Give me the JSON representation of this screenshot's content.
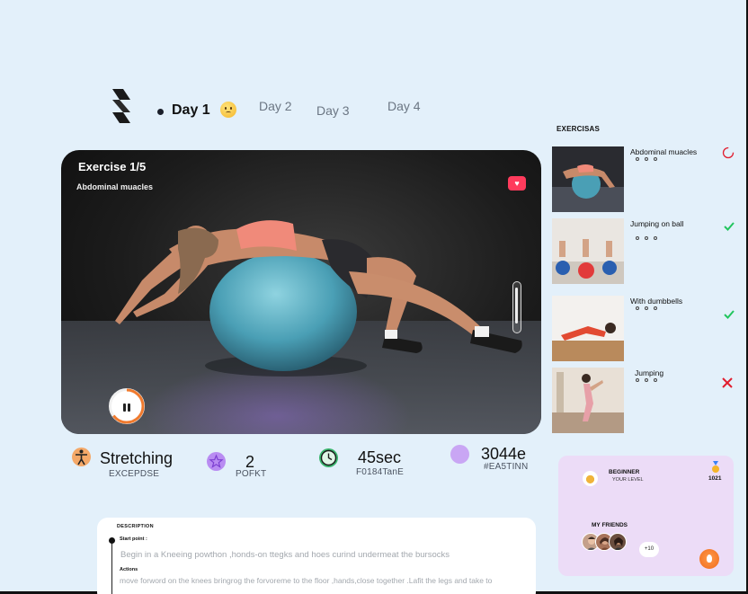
{
  "tabs": {
    "day1": "Day 1",
    "day2": "Day 2",
    "day3": "Day 3",
    "day4": "Day 4",
    "active_icon": "emoji-face-icon"
  },
  "player": {
    "title": "Exercise 1/5",
    "subtitle": "Abdominal muacles",
    "favorite_icon": "heart-icon",
    "pause_icon": "pause-icon",
    "progress": 0.65
  },
  "stats": [
    {
      "value": "Stretching",
      "sub": "EXCEPDSE",
      "icon": "person-stretch-icon",
      "color": "#f4a868"
    },
    {
      "value": "2",
      "sub": "POFKT",
      "icon": "star-icon",
      "color": "#b98cf2"
    },
    {
      "value": "45sec",
      "sub": "F0184TanE",
      "icon": "clock-icon",
      "color": "#3bb56e"
    },
    {
      "value": "3044e",
      "sub": "#EA5TINN",
      "icon": "circle-icon",
      "color": "#c9a6f4"
    }
  ],
  "exercises": {
    "heading": "EXERCISAS",
    "items": [
      {
        "name": "Abdominal muacles",
        "status": "in-progress",
        "status_icon": "spinner-icon"
      },
      {
        "name": "Jumping on ball",
        "status": "done",
        "status_icon": "check-icon"
      },
      {
        "name": "With dumbbells",
        "status": "done",
        "status_icon": "check-icon"
      },
      {
        "name": "Jumping",
        "status": "failed",
        "status_icon": "cross-icon"
      }
    ]
  },
  "description": {
    "title": "DESCRIPTION",
    "start_label": "Start point :",
    "start_text": "Begin in a Kneeing powthon ,honds-on ttegks and hoes curind undermeat the bursocks",
    "actions_label": "Actions",
    "actions_text": "move forword on the knees bringrog the forvoreme to the floor ,hands,close together .Lafit the legs and  take to"
  },
  "profile": {
    "level": "BEGINNER",
    "level_sub": "YOUR LEVEL",
    "score": "1021",
    "friends_title": "MY FRIENDS",
    "friends_more": "+10"
  },
  "colors": {
    "background": "#e3f0fa",
    "accent_heart": "#ff3b5c",
    "check": "#22c55e",
    "cross": "#e11d2e",
    "profile_bg": "#ecdcf7"
  }
}
